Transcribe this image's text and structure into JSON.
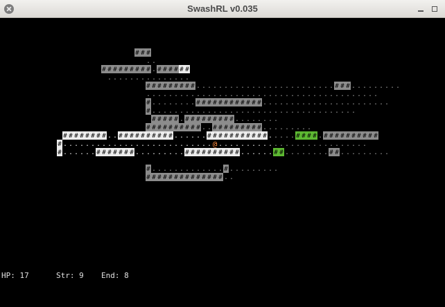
{
  "window": {
    "title": "SwashRL v0.035"
  },
  "status": {
    "hp": "HP: 17",
    "str": "Str: 9",
    "end": "End: 8"
  },
  "glyphs": {
    "wall": "#",
    "floor": ".",
    "player": "@"
  },
  "colors": {
    "lit": "#ececec",
    "remembered": "#8c8c8c",
    "floor_remembered": "#9a9a9a",
    "moss": "#5db832",
    "player": "#ff8a3c"
  },
  "map": {
    "rows": [
      "                        ###                                                     ",
      "                          ..                                                    ",
      "                  #########.####++                                              ",
      "                   ...............                                              ",
      "                          #########.........................###.........        ",
      "                          ..........................................           ",
      "                          #........############.......................         ",
      "                          #.....................................               ",
      "                           #####.#########........                              ",
      "                          ##########..#########.........                        ",
      "           ########..##########......###########.....====.##########            ",
      "          #...........................@...........................              ",
      "          #......#######.........##########......==........##.........          ",
      "                                                                                ",
      "                          #.............#.........                              ",
      "                          ##############..                                      "
    ]
  }
}
